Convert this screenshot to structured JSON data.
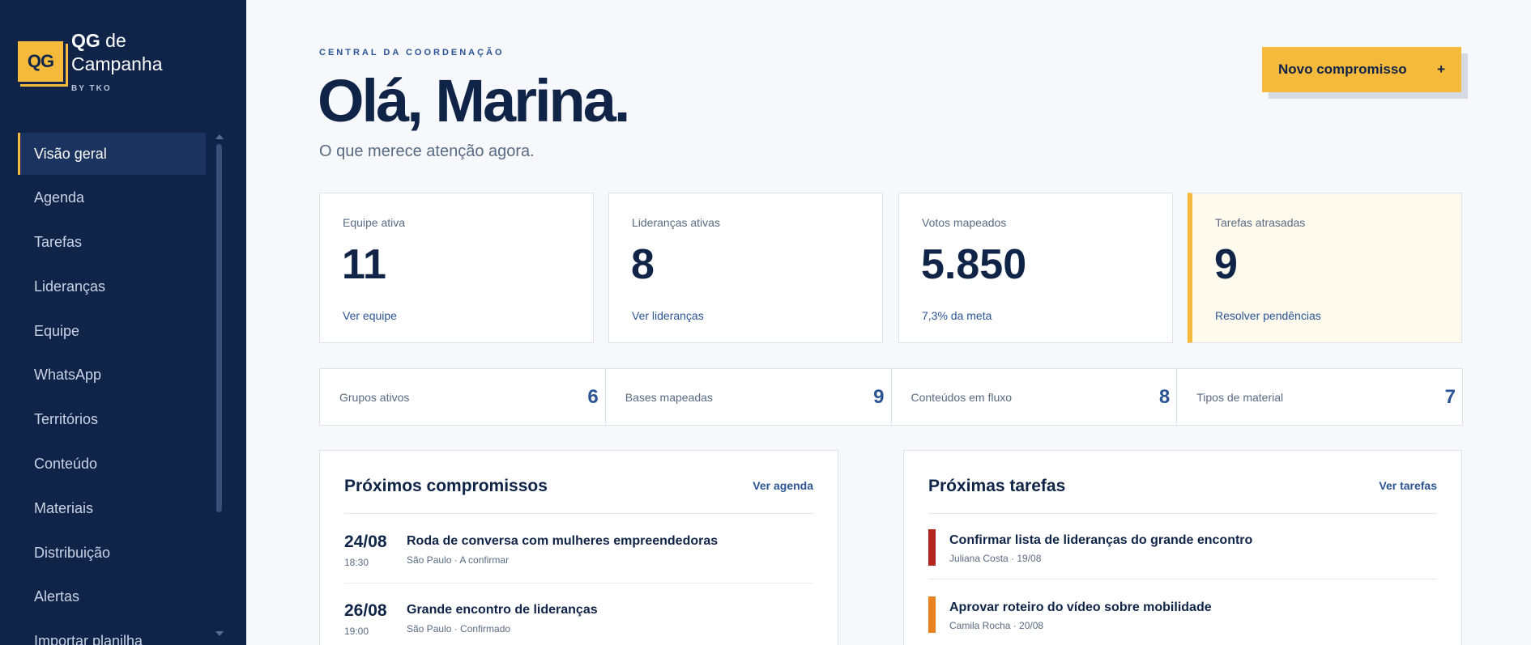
{
  "brand": {
    "logo_text": "QG",
    "title_bold": "QG",
    "title_rest": " de",
    "title_line2": "Campanha",
    "sub": "BY TKO"
  },
  "nav": {
    "items": [
      {
        "label": "Visão geral"
      },
      {
        "label": "Agenda"
      },
      {
        "label": "Tarefas"
      },
      {
        "label": "Lideranças"
      },
      {
        "label": "Equipe"
      },
      {
        "label": "WhatsApp"
      },
      {
        "label": "Territórios"
      },
      {
        "label": "Conteúdo"
      },
      {
        "label": "Materiais"
      },
      {
        "label": "Distribuição"
      },
      {
        "label": "Alertas"
      },
      {
        "label": "Importar planilha"
      }
    ],
    "active_index": 0
  },
  "header": {
    "eyebrow": "CENTRAL DA COORDENAÇÃO",
    "greeting": "Olá, Marina.",
    "subtitle": "O que merece atenção agora.",
    "new_button": "Novo compromisso",
    "new_button_icon": "+"
  },
  "kpis": [
    {
      "label": "Equipe ativa",
      "value": "11",
      "link": "Ver equipe"
    },
    {
      "label": "Lideranças ativas",
      "value": "8",
      "link": "Ver lideranças"
    },
    {
      "label": "Votos mapeados",
      "value": "5.850",
      "link": "7,3% da meta"
    },
    {
      "label": "Tarefas atrasadas",
      "value": "9",
      "link": "Resolver pendências"
    }
  ],
  "stats": [
    {
      "label": "Grupos ativos",
      "value": "6"
    },
    {
      "label": "Bases mapeadas",
      "value": "9"
    },
    {
      "label": "Conteúdos em fluxo",
      "value": "8"
    },
    {
      "label": "Tipos de material",
      "value": "7"
    }
  ],
  "agenda": {
    "title": "Próximos compromissos",
    "link": "Ver agenda",
    "events": [
      {
        "date": "24/08",
        "time": "18:30",
        "title": "Roda de conversa com mulheres empreendedoras",
        "meta": "São Paulo · A confirmar"
      },
      {
        "date": "26/08",
        "time": "19:00",
        "title": "Grande encontro de lideranças",
        "meta": "São Paulo · Confirmado"
      }
    ]
  },
  "tasks": {
    "title": "Próximas tarefas",
    "link": "Ver tarefas",
    "items": [
      {
        "title": "Confirmar lista de lideranças do grande encontro",
        "meta": "Juliana Costa · 19/08",
        "color": "#b3261e"
      },
      {
        "title": "Aprovar roteiro do vídeo sobre mobilidade",
        "meta": "Camila Rocha · 20/08",
        "color": "#e8821e"
      }
    ]
  },
  "colors": {
    "accent": "#f5b93c",
    "sidebar": "#10244a",
    "link": "#2a5494"
  }
}
